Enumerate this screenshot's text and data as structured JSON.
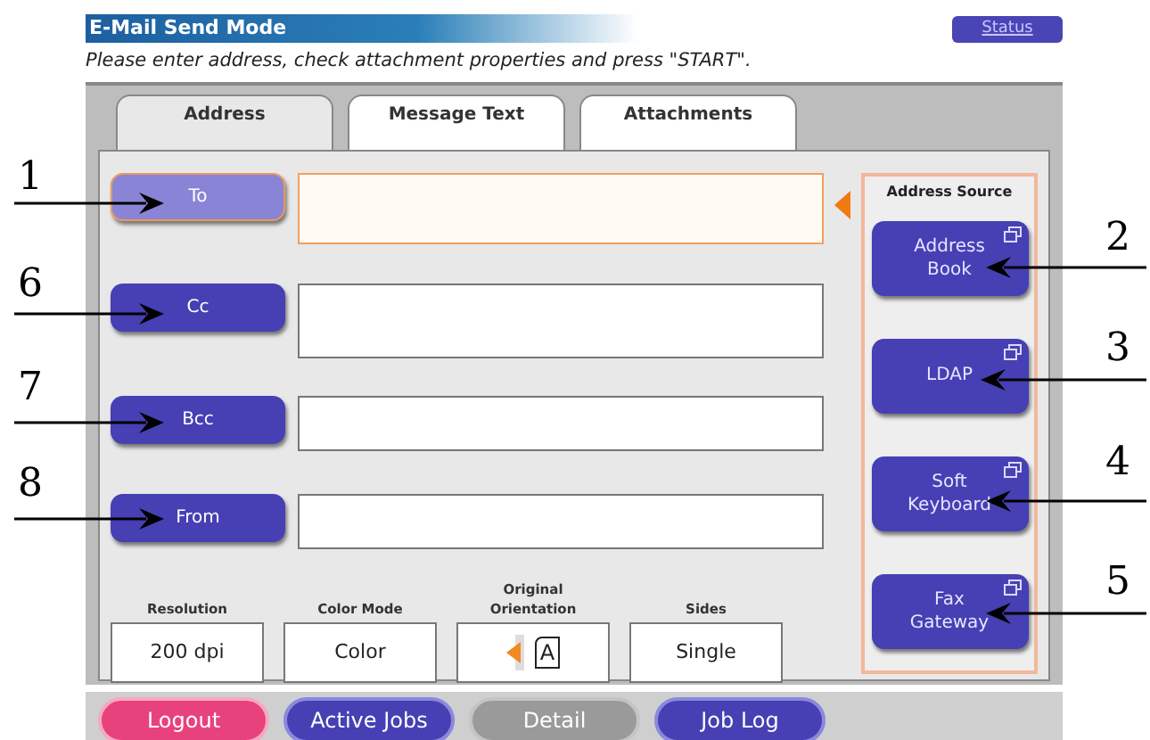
{
  "title": "E-Mail Send Mode",
  "status_button": "Status",
  "instruction": "Please enter address, check attachment properties and press \"START\".",
  "tabs": [
    {
      "label": "Address",
      "selected": true
    },
    {
      "label": "Message Text",
      "selected": false
    },
    {
      "label": "Attachments",
      "selected": false
    }
  ],
  "recipients": [
    {
      "label": "To",
      "selected": true
    },
    {
      "label": "Cc",
      "selected": false
    },
    {
      "label": "Bcc",
      "selected": false
    },
    {
      "label": "From",
      "selected": false
    }
  ],
  "address_source": {
    "title": "Address Source",
    "buttons": [
      {
        "label": "Address Book"
      },
      {
        "label": "LDAP"
      },
      {
        "label": "Soft Keyboard"
      },
      {
        "label": "Fax Gateway"
      }
    ]
  },
  "settings": [
    {
      "kind": "text",
      "label": "Resolution",
      "value": "200 dpi"
    },
    {
      "kind": "text",
      "label": "Color Mode",
      "value": "Color"
    },
    {
      "kind": "orientation",
      "label": "Original Orientation",
      "value": "A"
    },
    {
      "kind": "text",
      "label": "Sides",
      "value": "Single"
    }
  ],
  "bottom_buttons": [
    {
      "label": "Logout",
      "kind": "logout",
      "disabled": false
    },
    {
      "label": "Active Jobs",
      "kind": "normal",
      "disabled": false
    },
    {
      "label": "Detail",
      "kind": "normal",
      "disabled": true
    },
    {
      "label": "Job Log",
      "kind": "normal",
      "disabled": false
    }
  ],
  "callouts": [
    {
      "number": "1"
    },
    {
      "number": "6"
    },
    {
      "number": "7"
    },
    {
      "number": "8"
    },
    {
      "number": "2"
    },
    {
      "number": "3"
    },
    {
      "number": "4"
    },
    {
      "number": "5"
    }
  ]
}
